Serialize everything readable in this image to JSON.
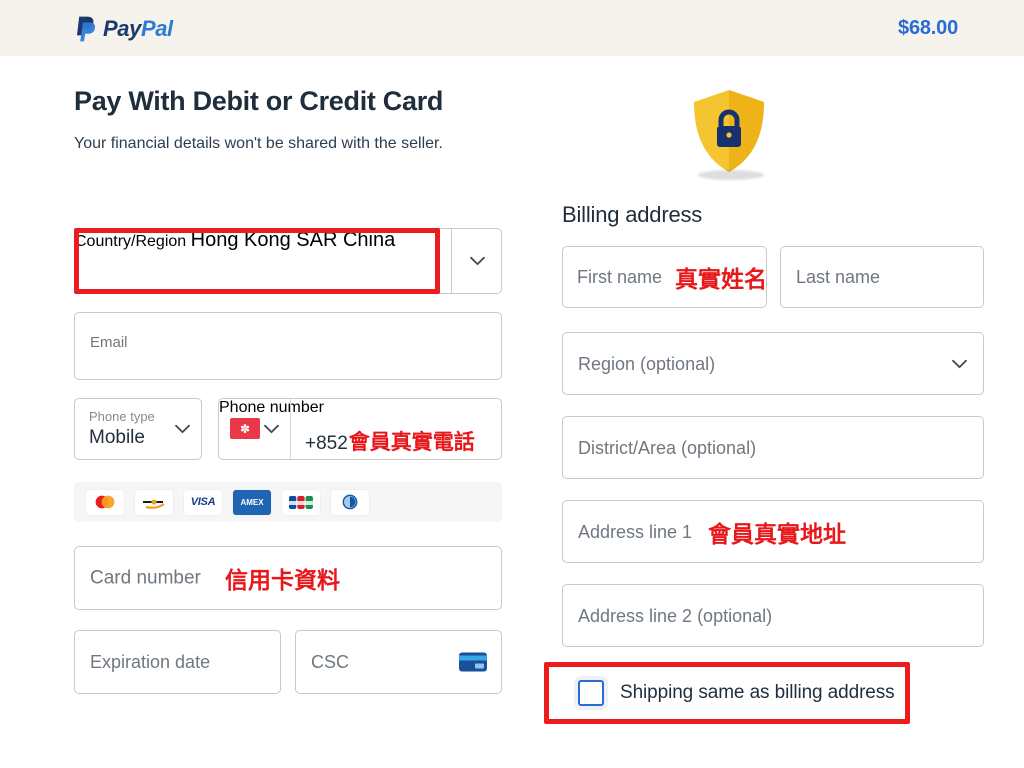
{
  "header": {
    "brand_pay": "Pay",
    "brand_pal": "Pal",
    "amount": "$68.00",
    "background_color": "#f5f3ec",
    "brand_blue": "#2b6cd4"
  },
  "left": {
    "title": "Pay With Debit or Credit Card",
    "subtitle": "Your financial details won't be shared with the seller.",
    "country": {
      "label": "Country/Region",
      "value": "Hong Kong SAR China",
      "dropdown_icon": "chevron-down-icon",
      "highlighted": true
    },
    "email": {
      "placeholder": "Email"
    },
    "phone_type": {
      "label": "Phone type",
      "value": "Mobile",
      "dropdown_icon": "chevron-down-icon"
    },
    "phone_number": {
      "label": "Phone number",
      "country_flag": "hong-kong-flag-icon",
      "prefix": "+852",
      "annotation": "會員真實電話",
      "dropdown_icon": "chevron-down-icon"
    },
    "card_logos": [
      "mastercard-icon",
      "maestro-icon",
      "visa-icon",
      "amex-icon",
      "jcb-icon",
      "diners-club-icon"
    ],
    "card_number": {
      "placeholder": "Card number",
      "annotation": "信用卡資料"
    },
    "expiration": {
      "placeholder": "Expiration date"
    },
    "csc": {
      "placeholder": "CSC",
      "icon": "credit-card-icon"
    }
  },
  "right": {
    "shield_icon": "shield-lock-icon",
    "heading": "Billing address",
    "first_name": {
      "placeholder": "First name",
      "annotation": "真實姓名"
    },
    "last_name": {
      "placeholder": "Last name"
    },
    "region": {
      "placeholder": "Region (optional)",
      "dropdown_icon": "chevron-down-icon"
    },
    "district": {
      "placeholder": "District/Area (optional)"
    },
    "address_line_1": {
      "placeholder": "Address line 1",
      "annotation": "會員真實地址"
    },
    "address_line_2": {
      "placeholder": "Address line 2 (optional)"
    },
    "shipping_same": {
      "label": "Shipping same as billing address",
      "checked": false,
      "highlighted": true
    }
  },
  "annotation_color": "#ec1c1c"
}
